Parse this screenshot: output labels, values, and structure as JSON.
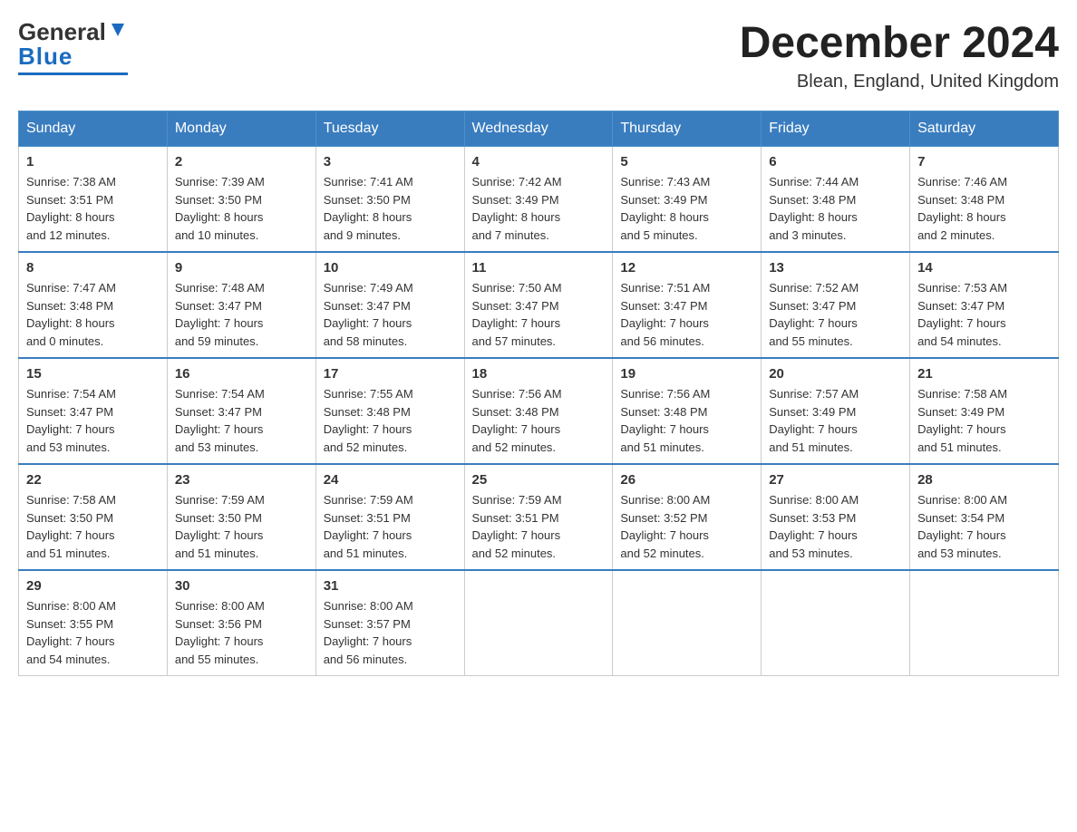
{
  "header": {
    "logo": {
      "line1": "General",
      "line2": "Blue",
      "triangle_color": "#1a6bbf"
    },
    "title": "December 2024",
    "location": "Blean, England, United Kingdom"
  },
  "days_of_week": [
    "Sunday",
    "Monday",
    "Tuesday",
    "Wednesday",
    "Thursday",
    "Friday",
    "Saturday"
  ],
  "weeks": [
    [
      {
        "day": "1",
        "sunrise": "Sunrise: 7:38 AM",
        "sunset": "Sunset: 3:51 PM",
        "daylight": "Daylight: 8 hours",
        "daylight2": "and 12 minutes."
      },
      {
        "day": "2",
        "sunrise": "Sunrise: 7:39 AM",
        "sunset": "Sunset: 3:50 PM",
        "daylight": "Daylight: 8 hours",
        "daylight2": "and 10 minutes."
      },
      {
        "day": "3",
        "sunrise": "Sunrise: 7:41 AM",
        "sunset": "Sunset: 3:50 PM",
        "daylight": "Daylight: 8 hours",
        "daylight2": "and 9 minutes."
      },
      {
        "day": "4",
        "sunrise": "Sunrise: 7:42 AM",
        "sunset": "Sunset: 3:49 PM",
        "daylight": "Daylight: 8 hours",
        "daylight2": "and 7 minutes."
      },
      {
        "day": "5",
        "sunrise": "Sunrise: 7:43 AM",
        "sunset": "Sunset: 3:49 PM",
        "daylight": "Daylight: 8 hours",
        "daylight2": "and 5 minutes."
      },
      {
        "day": "6",
        "sunrise": "Sunrise: 7:44 AM",
        "sunset": "Sunset: 3:48 PM",
        "daylight": "Daylight: 8 hours",
        "daylight2": "and 3 minutes."
      },
      {
        "day": "7",
        "sunrise": "Sunrise: 7:46 AM",
        "sunset": "Sunset: 3:48 PM",
        "daylight": "Daylight: 8 hours",
        "daylight2": "and 2 minutes."
      }
    ],
    [
      {
        "day": "8",
        "sunrise": "Sunrise: 7:47 AM",
        "sunset": "Sunset: 3:48 PM",
        "daylight": "Daylight: 8 hours",
        "daylight2": "and 0 minutes."
      },
      {
        "day": "9",
        "sunrise": "Sunrise: 7:48 AM",
        "sunset": "Sunset: 3:47 PM",
        "daylight": "Daylight: 7 hours",
        "daylight2": "and 59 minutes."
      },
      {
        "day": "10",
        "sunrise": "Sunrise: 7:49 AM",
        "sunset": "Sunset: 3:47 PM",
        "daylight": "Daylight: 7 hours",
        "daylight2": "and 58 minutes."
      },
      {
        "day": "11",
        "sunrise": "Sunrise: 7:50 AM",
        "sunset": "Sunset: 3:47 PM",
        "daylight": "Daylight: 7 hours",
        "daylight2": "and 57 minutes."
      },
      {
        "day": "12",
        "sunrise": "Sunrise: 7:51 AM",
        "sunset": "Sunset: 3:47 PM",
        "daylight": "Daylight: 7 hours",
        "daylight2": "and 56 minutes."
      },
      {
        "day": "13",
        "sunrise": "Sunrise: 7:52 AM",
        "sunset": "Sunset: 3:47 PM",
        "daylight": "Daylight: 7 hours",
        "daylight2": "and 55 minutes."
      },
      {
        "day": "14",
        "sunrise": "Sunrise: 7:53 AM",
        "sunset": "Sunset: 3:47 PM",
        "daylight": "Daylight: 7 hours",
        "daylight2": "and 54 minutes."
      }
    ],
    [
      {
        "day": "15",
        "sunrise": "Sunrise: 7:54 AM",
        "sunset": "Sunset: 3:47 PM",
        "daylight": "Daylight: 7 hours",
        "daylight2": "and 53 minutes."
      },
      {
        "day": "16",
        "sunrise": "Sunrise: 7:54 AM",
        "sunset": "Sunset: 3:47 PM",
        "daylight": "Daylight: 7 hours",
        "daylight2": "and 53 minutes."
      },
      {
        "day": "17",
        "sunrise": "Sunrise: 7:55 AM",
        "sunset": "Sunset: 3:48 PM",
        "daylight": "Daylight: 7 hours",
        "daylight2": "and 52 minutes."
      },
      {
        "day": "18",
        "sunrise": "Sunrise: 7:56 AM",
        "sunset": "Sunset: 3:48 PM",
        "daylight": "Daylight: 7 hours",
        "daylight2": "and 52 minutes."
      },
      {
        "day": "19",
        "sunrise": "Sunrise: 7:56 AM",
        "sunset": "Sunset: 3:48 PM",
        "daylight": "Daylight: 7 hours",
        "daylight2": "and 51 minutes."
      },
      {
        "day": "20",
        "sunrise": "Sunrise: 7:57 AM",
        "sunset": "Sunset: 3:49 PM",
        "daylight": "Daylight: 7 hours",
        "daylight2": "and 51 minutes."
      },
      {
        "day": "21",
        "sunrise": "Sunrise: 7:58 AM",
        "sunset": "Sunset: 3:49 PM",
        "daylight": "Daylight: 7 hours",
        "daylight2": "and 51 minutes."
      }
    ],
    [
      {
        "day": "22",
        "sunrise": "Sunrise: 7:58 AM",
        "sunset": "Sunset: 3:50 PM",
        "daylight": "Daylight: 7 hours",
        "daylight2": "and 51 minutes."
      },
      {
        "day": "23",
        "sunrise": "Sunrise: 7:59 AM",
        "sunset": "Sunset: 3:50 PM",
        "daylight": "Daylight: 7 hours",
        "daylight2": "and 51 minutes."
      },
      {
        "day": "24",
        "sunrise": "Sunrise: 7:59 AM",
        "sunset": "Sunset: 3:51 PM",
        "daylight": "Daylight: 7 hours",
        "daylight2": "and 51 minutes."
      },
      {
        "day": "25",
        "sunrise": "Sunrise: 7:59 AM",
        "sunset": "Sunset: 3:51 PM",
        "daylight": "Daylight: 7 hours",
        "daylight2": "and 52 minutes."
      },
      {
        "day": "26",
        "sunrise": "Sunrise: 8:00 AM",
        "sunset": "Sunset: 3:52 PM",
        "daylight": "Daylight: 7 hours",
        "daylight2": "and 52 minutes."
      },
      {
        "day": "27",
        "sunrise": "Sunrise: 8:00 AM",
        "sunset": "Sunset: 3:53 PM",
        "daylight": "Daylight: 7 hours",
        "daylight2": "and 53 minutes."
      },
      {
        "day": "28",
        "sunrise": "Sunrise: 8:00 AM",
        "sunset": "Sunset: 3:54 PM",
        "daylight": "Daylight: 7 hours",
        "daylight2": "and 53 minutes."
      }
    ],
    [
      {
        "day": "29",
        "sunrise": "Sunrise: 8:00 AM",
        "sunset": "Sunset: 3:55 PM",
        "daylight": "Daylight: 7 hours",
        "daylight2": "and 54 minutes."
      },
      {
        "day": "30",
        "sunrise": "Sunrise: 8:00 AM",
        "sunset": "Sunset: 3:56 PM",
        "daylight": "Daylight: 7 hours",
        "daylight2": "and 55 minutes."
      },
      {
        "day": "31",
        "sunrise": "Sunrise: 8:00 AM",
        "sunset": "Sunset: 3:57 PM",
        "daylight": "Daylight: 7 hours",
        "daylight2": "and 56 minutes."
      },
      {
        "day": "",
        "sunrise": "",
        "sunset": "",
        "daylight": "",
        "daylight2": ""
      },
      {
        "day": "",
        "sunrise": "",
        "sunset": "",
        "daylight": "",
        "daylight2": ""
      },
      {
        "day": "",
        "sunrise": "",
        "sunset": "",
        "daylight": "",
        "daylight2": ""
      },
      {
        "day": "",
        "sunrise": "",
        "sunset": "",
        "daylight": "",
        "daylight2": ""
      }
    ]
  ]
}
